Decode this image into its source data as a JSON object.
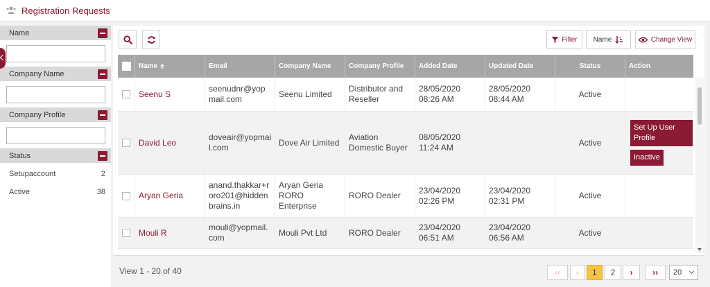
{
  "header": {
    "title": "Registration Requests",
    "icon": "users-icon"
  },
  "filters": [
    {
      "label": "Name"
    },
    {
      "label": "Company Name"
    },
    {
      "label": "Company Profile"
    }
  ],
  "status_filter": {
    "label": "Status",
    "items": [
      {
        "label": "Setupaccount",
        "count": "2"
      },
      {
        "label": "Active",
        "count": "38"
      }
    ]
  },
  "toolbar": {
    "filter_label": "Filter",
    "sort_label": "Name",
    "change_view_label": "Change View"
  },
  "columns": [
    "Name",
    "Email",
    "Company Name",
    "Company Profile",
    "Added Date",
    "Updated Date",
    "Status",
    "Action"
  ],
  "rows": [
    {
      "name": "Seenu S",
      "email": "seenudnr@yopmail.com",
      "company": "Seenu Limited",
      "profile": "Distributor and Reseller",
      "added": "28/05/2020 08:26 AM",
      "updated": "28/05/2020 08:44 AM",
      "status": "Active"
    },
    {
      "name": "David Leo",
      "email": "doveair@yopmail.com",
      "company": "Dove Air Limited",
      "profile": "Aviation Domestic Buyer",
      "added": "08/05/2020 11:24 AM",
      "updated": "",
      "status": "Active",
      "action1": "Set Up User Profile",
      "action2": "Inactive"
    },
    {
      "name": "Aryan Geria",
      "email": "anand.thakkar+roro201@hiddenbrains.in",
      "company": "Aryan Geria RORO Enterprise",
      "profile": "RORO Dealer",
      "added": "23/04/2020 02:26 PM",
      "updated": "23/04/2020 02:31 PM",
      "status": "Active"
    },
    {
      "name": "Mouli R",
      "email": "mouli@yopmail.com",
      "company": "Mouli Pvt Ltd",
      "profile": "RORO Dealer",
      "added": "23/04/2020 06:51 AM",
      "updated": "23/04/2020 06:56 AM",
      "status": "Active"
    }
  ],
  "footer": {
    "view_text": "View 1 - 20 of 40",
    "page1": "1",
    "page2": "2",
    "page_size": "20"
  },
  "colors": {
    "accent": "#8b1a34",
    "header_gray": "#a6a6a6",
    "active_page": "#f4c542"
  }
}
